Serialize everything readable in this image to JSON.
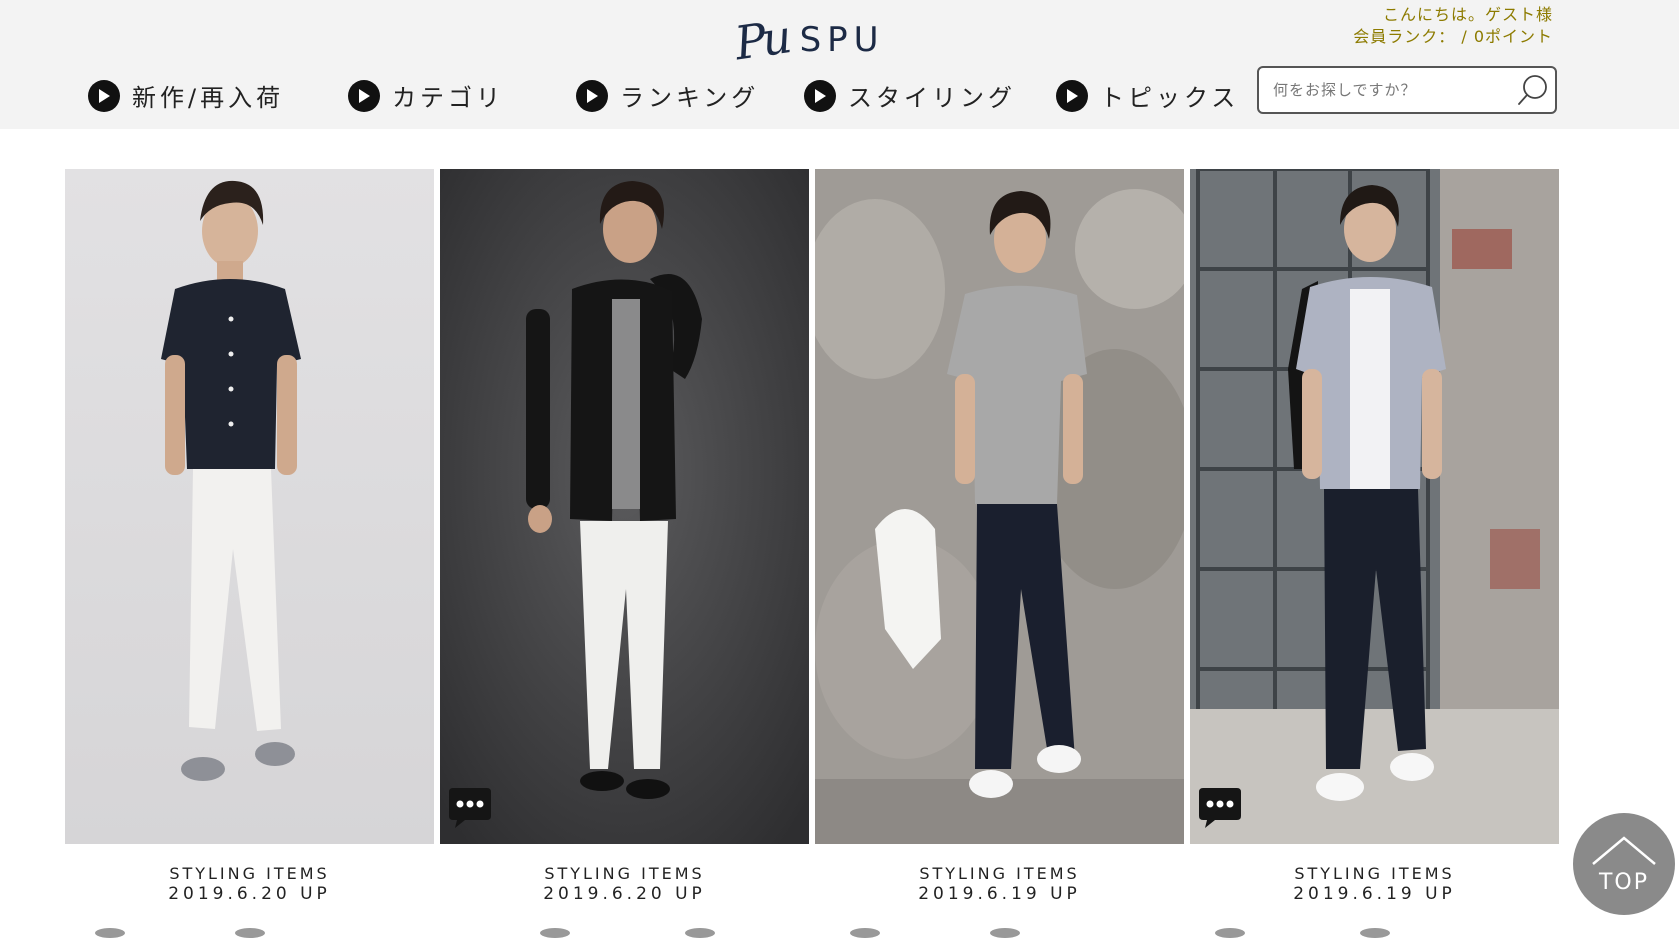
{
  "header": {
    "logo_mark": "Pu",
    "logo_text": "SPU",
    "greeting_line1": "こんにちは。ゲスト様",
    "greeting_line2": "会員ランク：  / 0ポイント",
    "accent_color": "#8d7b00",
    "nav": [
      {
        "label": "新作/再入荷",
        "icon": "play-circle-icon"
      },
      {
        "label": "カテゴリ",
        "icon": "play-circle-icon"
      },
      {
        "label": "ランキング",
        "icon": "play-circle-icon"
      },
      {
        "label": "スタイリング",
        "icon": "play-circle-icon"
      },
      {
        "label": "トピックス",
        "icon": "play-circle-icon"
      }
    ],
    "search": {
      "placeholder": "何をお探しですか？",
      "value": "",
      "icon": "search-icon"
    }
  },
  "cards": [
    {
      "title": "STYLING ITEMS",
      "date": "2019.6.20 UP",
      "has_chat_badge": false
    },
    {
      "title": "STYLING ITEMS",
      "date": "2019.6.20 UP",
      "has_chat_badge": true
    },
    {
      "title": "STYLING ITEMS",
      "date": "2019.6.19 UP",
      "has_chat_badge": false
    },
    {
      "title": "STYLING ITEMS",
      "date": "2019.6.19 UP",
      "has_chat_badge": true
    }
  ],
  "back_to_top": {
    "label": "TOP",
    "icon": "chevron-up-icon"
  }
}
